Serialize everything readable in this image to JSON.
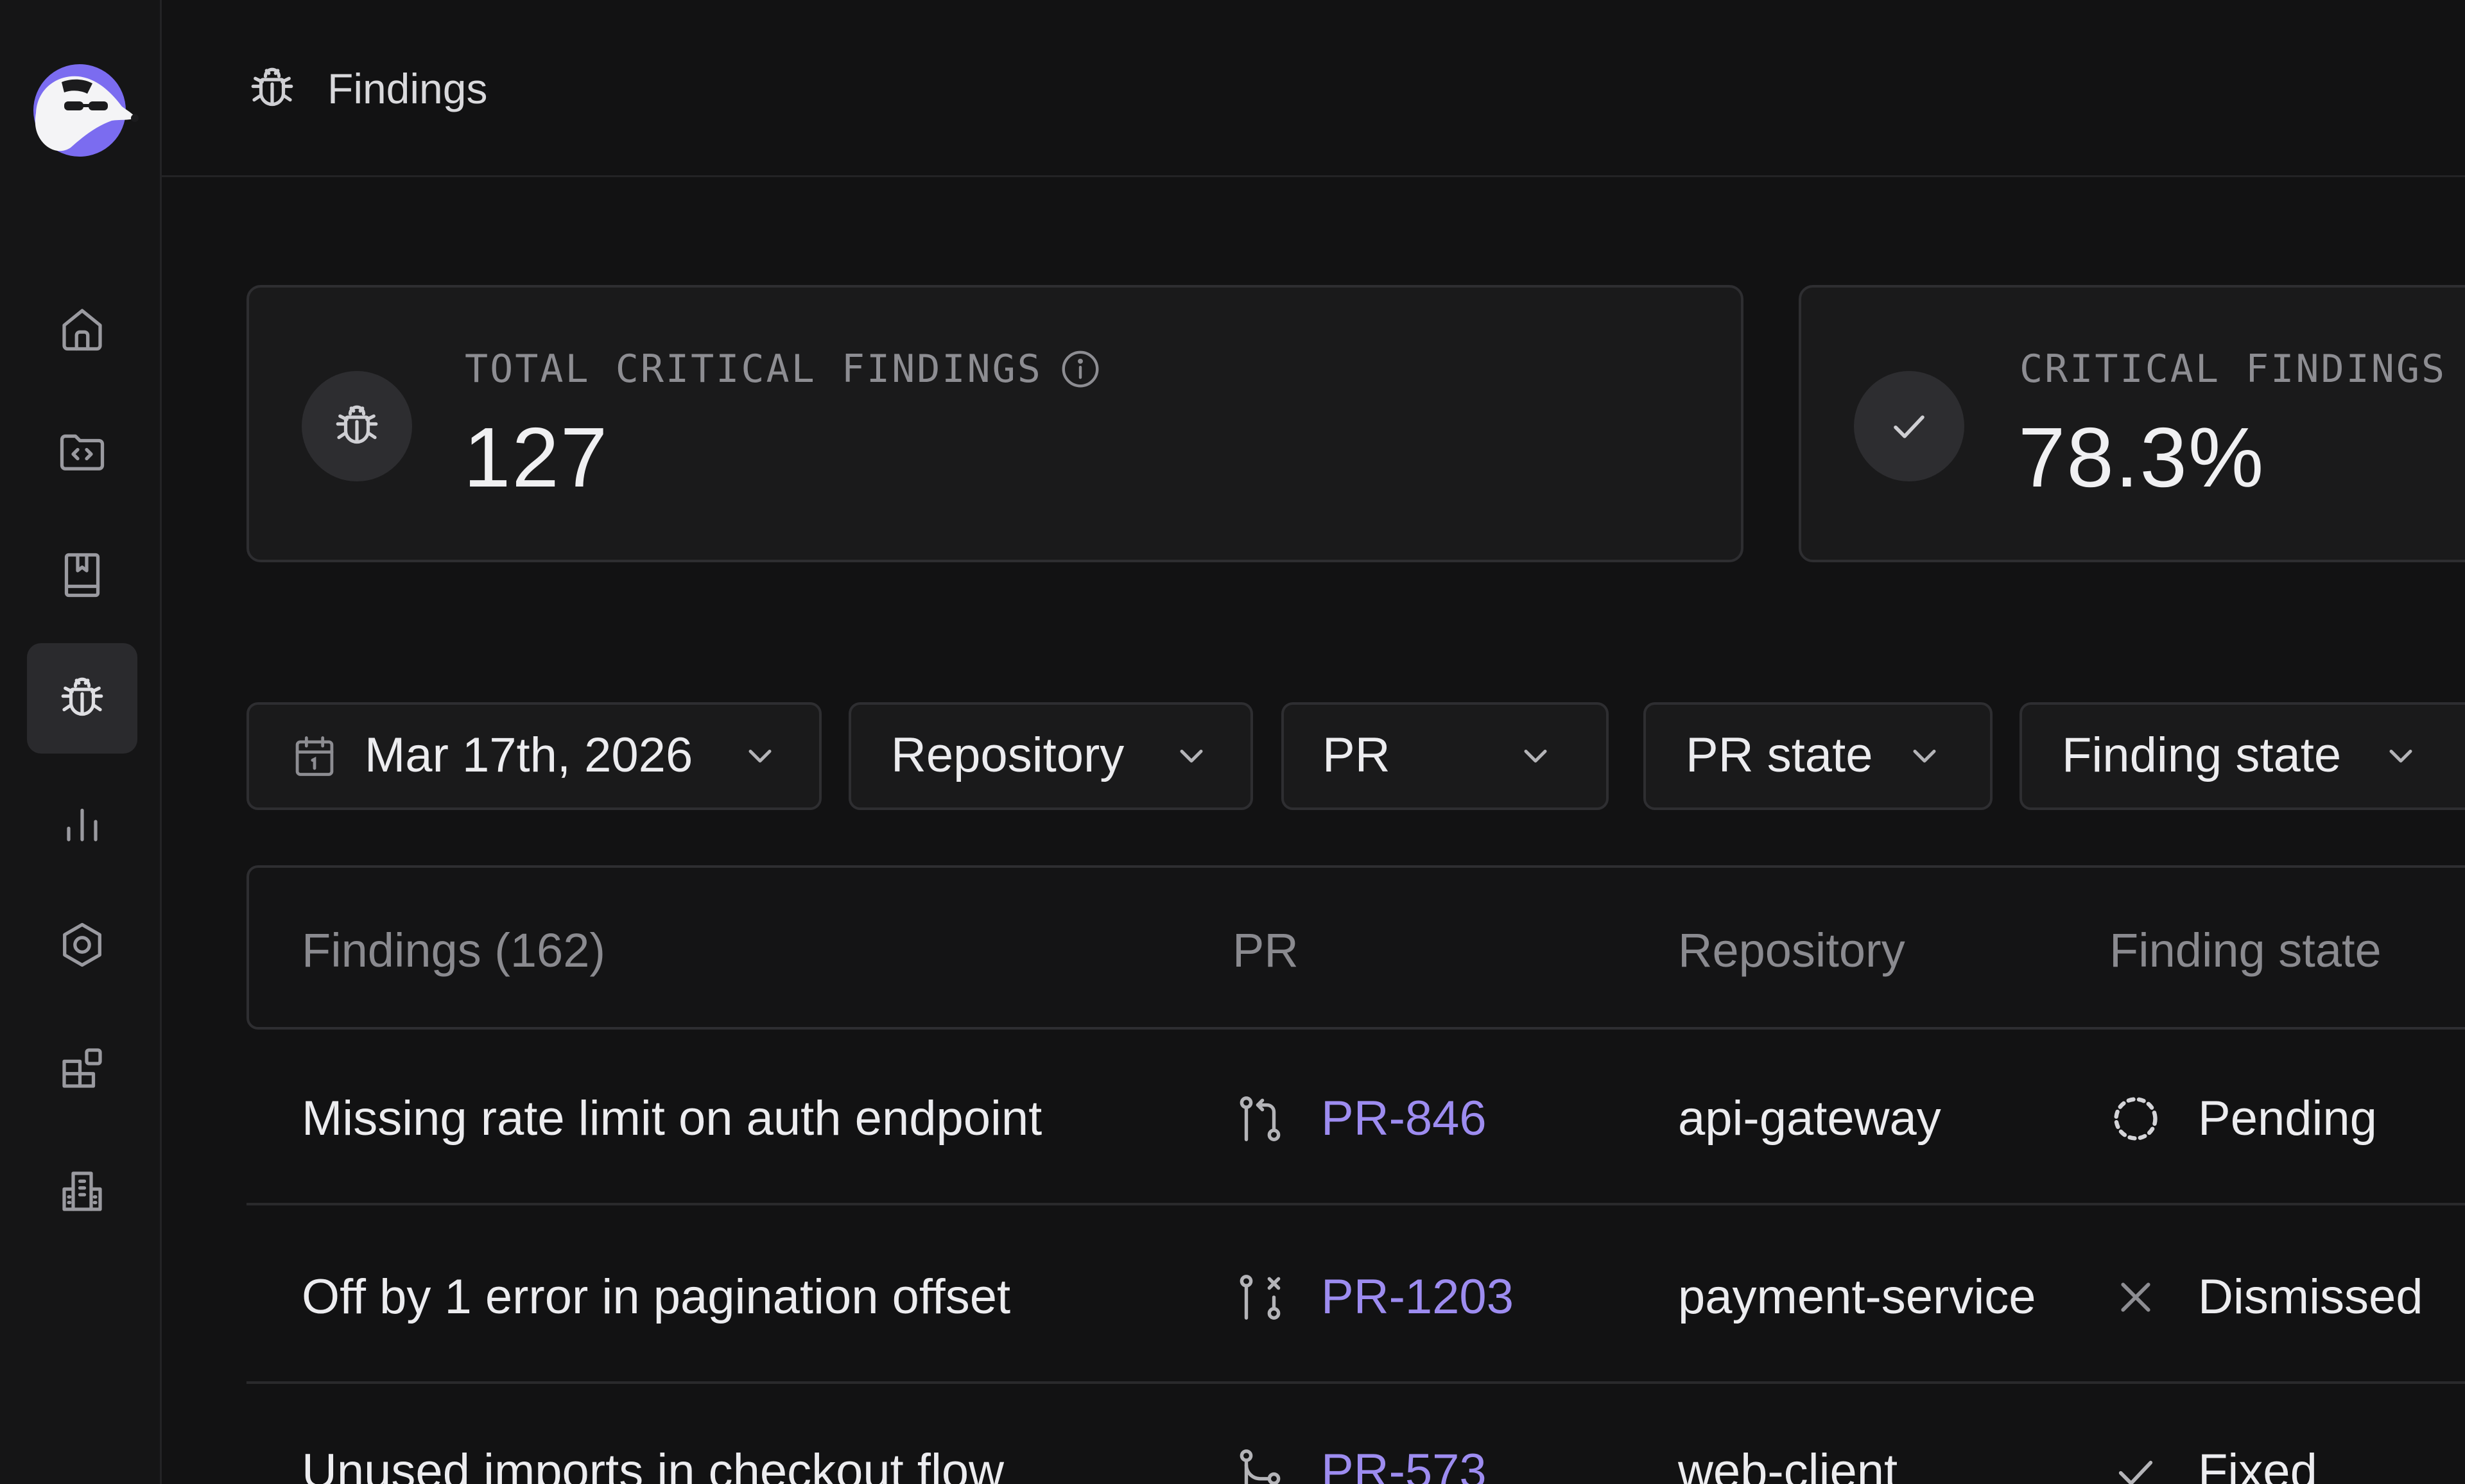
{
  "header": {
    "title": "Findings",
    "icon": "bug-icon"
  },
  "sidebar": {
    "items": [
      {
        "name": "home",
        "icon": "home-icon",
        "active": false
      },
      {
        "name": "repositories",
        "icon": "code-folder-icon",
        "active": false
      },
      {
        "name": "docs",
        "icon": "book-icon",
        "active": false
      },
      {
        "name": "findings",
        "icon": "bug-icon",
        "active": true
      },
      {
        "name": "analytics",
        "icon": "bar-chart-icon",
        "active": false
      },
      {
        "name": "settings",
        "icon": "hexagon-settings-icon",
        "active": false
      },
      {
        "name": "integrations",
        "icon": "blocks-icon",
        "active": false
      },
      {
        "name": "organization",
        "icon": "building-icon",
        "active": false
      }
    ]
  },
  "stats": [
    {
      "label": "TOTAL CRITICAL FINDINGS",
      "value": "127",
      "icon": "bug-icon",
      "has_info": true
    },
    {
      "label": "CRITICAL FINDINGS",
      "value": "78.3%",
      "icon": "check-icon",
      "has_info": false
    }
  ],
  "filters": {
    "date": "Mar 17th, 2026",
    "repository": "Repository",
    "pr": "PR",
    "pr_state": "PR state",
    "finding_state": "Finding state"
  },
  "table": {
    "headers": {
      "findings": "Findings (162)",
      "pr": "PR",
      "repository": "Repository",
      "finding_state": "Finding state"
    },
    "rows": [
      {
        "title": "Missing rate limit on auth endpoint",
        "pr": "PR-846",
        "pr_icon": "pull-request-open-icon",
        "repository": "api-gateway",
        "state": "Pending",
        "state_icon": "pending-dashed-circle-icon"
      },
      {
        "title": "Off by 1 error in pagination offset",
        "pr": "PR-1203",
        "pr_icon": "pull-request-closed-icon",
        "repository": "payment-service",
        "state": "Dismissed",
        "state_icon": "x-icon"
      },
      {
        "title": "Unused imports in checkout flow",
        "pr": "PR-573",
        "pr_icon": "pull-request-merged-icon",
        "repository": "web-client",
        "state": "Fixed",
        "state_icon": "check-icon"
      }
    ]
  },
  "colors": {
    "background": "#121213",
    "card": "#1a1a1b",
    "border": "#2e2e31",
    "link": "#9d8cf0",
    "brand_purple": "#7b6cf0"
  }
}
